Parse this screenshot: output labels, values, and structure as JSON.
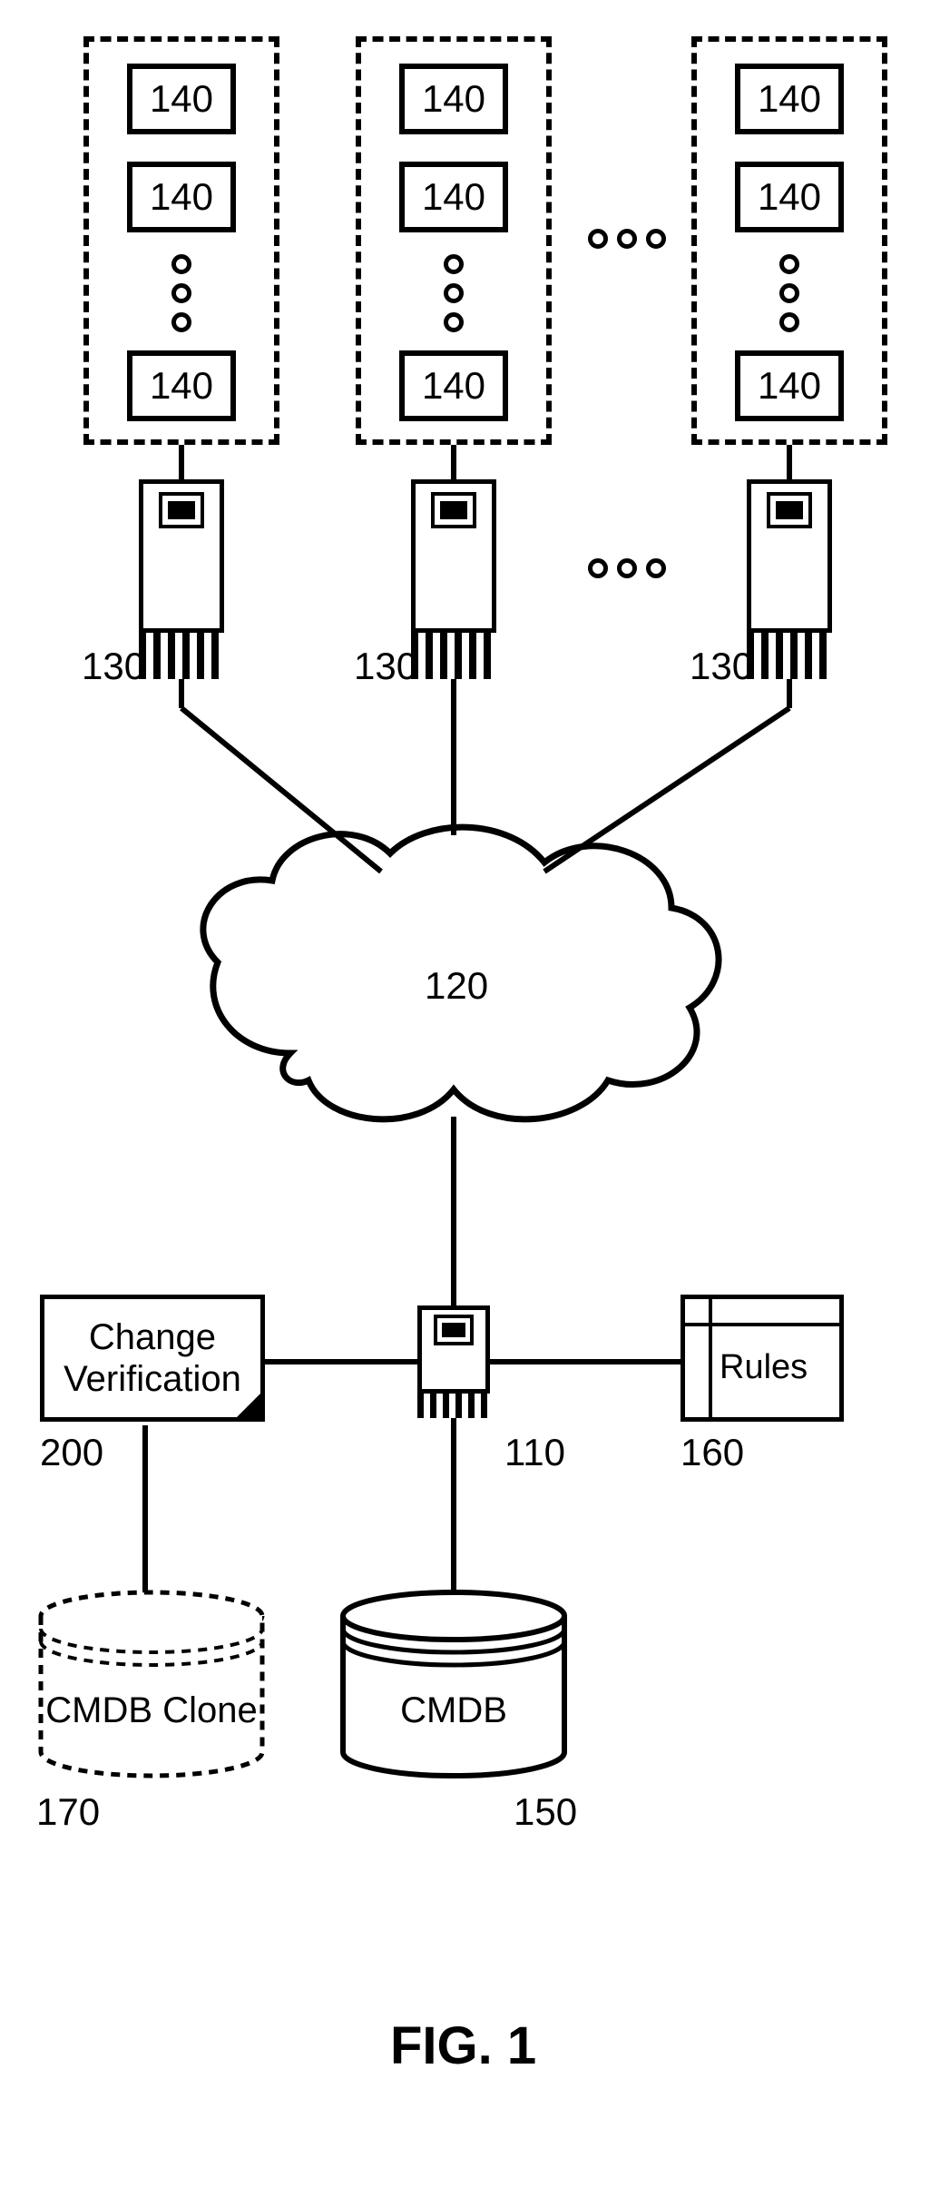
{
  "figure_title": "FIG. 1",
  "groups": {
    "item_label": "140"
  },
  "server_row_label": "130",
  "server_ellipsis": "○○○",
  "cloud_label": "120",
  "change_verification": {
    "label": "Change\nVerification",
    "ref": "200"
  },
  "central_server_ref": "110",
  "rules": {
    "label": "Rules",
    "ref": "160"
  },
  "cmdb_clone": {
    "label": "CMDB Clone",
    "ref": "170"
  },
  "cmdb": {
    "label": "CMDB",
    "ref": "150"
  }
}
